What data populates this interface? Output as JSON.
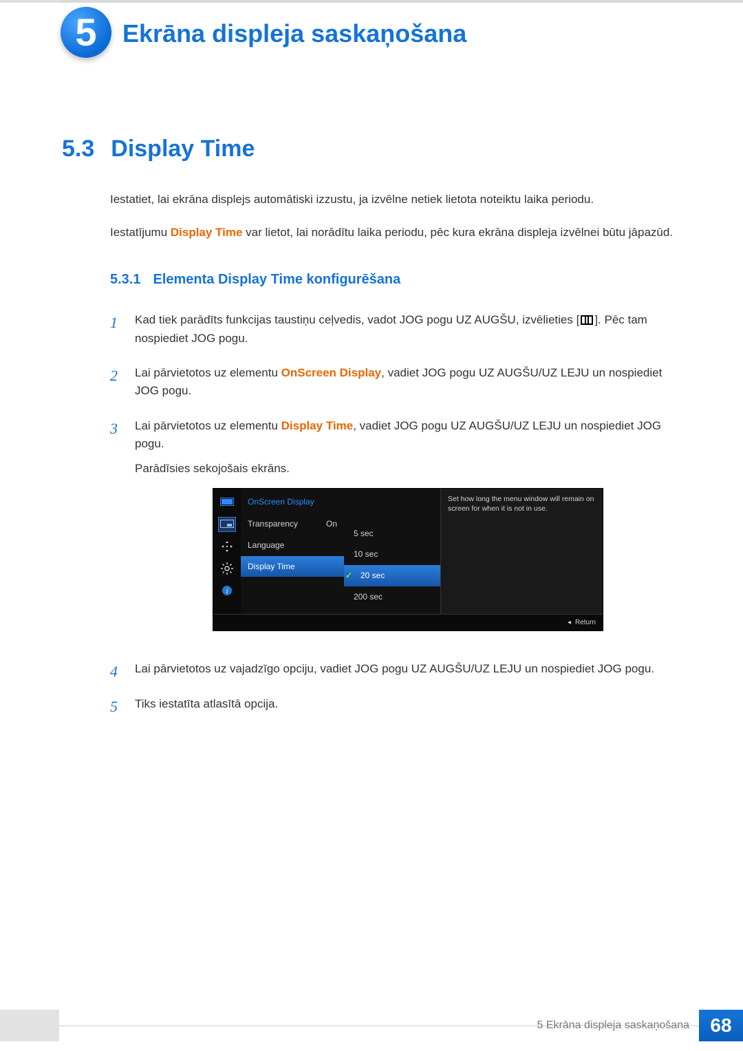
{
  "chapter": {
    "number": "5",
    "title": "Ekrāna displeja saskaņošana"
  },
  "section": {
    "number": "5.3",
    "title": "Display Time"
  },
  "intro1": "Iestatiet, lai ekrāna displejs automātiski izzustu, ja izvēlne netiek lietota noteiktu laika periodu.",
  "intro2a": "Iestatījumu ",
  "intro2_em": "Display Time",
  "intro2b": " var lietot, lai norādītu laika periodu, pēc kura ekrāna displeja izvēlnei būtu jāpazūd.",
  "subsection": {
    "number": "5.3.1",
    "title": "Elementa Display Time konfigurēšana"
  },
  "steps": {
    "1a": "Kad tiek parādīts funkcijas taustiņu ceļvedis, vadot JOG pogu UZ AUGŠU, izvēlieties [",
    "1b": "]. Pēc tam nospiediet JOG pogu.",
    "2a": "Lai pārvietotos uz elementu ",
    "2_em": "OnScreen Display",
    "2b": ", vadiet JOG pogu UZ AUGŠU/UZ LEJU un nospiediet JOG pogu.",
    "3a": "Lai pārvietotos uz elementu ",
    "3_em": "Display Time",
    "3b": ", vadiet JOG pogu UZ AUGŠU/UZ LEJU un nospiediet JOG pogu.",
    "3c": "Parādīsies sekojošais ekrāns.",
    "4": "Lai pārvietotos uz vajadzīgo opciju, vadiet JOG pogu UZ AUGŠU/UZ LEJU un nospiediet JOG pogu.",
    "5": "Tiks iestatīta atlasītā opcija."
  },
  "osd": {
    "title": "OnScreen Display",
    "transparency_label": "Transparency",
    "transparency_value": "On",
    "language_label": "Language",
    "display_time_label": "Display Time",
    "options": [
      "5 sec",
      "10 sec",
      "20 sec",
      "200 sec"
    ],
    "selected": "20 sec",
    "help": "Set how long the menu window will remain on screen for when it is not in use.",
    "return": "Return"
  },
  "footer": {
    "chapter_label": "5 Ekrāna displeja saskaņošana",
    "page": "68"
  }
}
